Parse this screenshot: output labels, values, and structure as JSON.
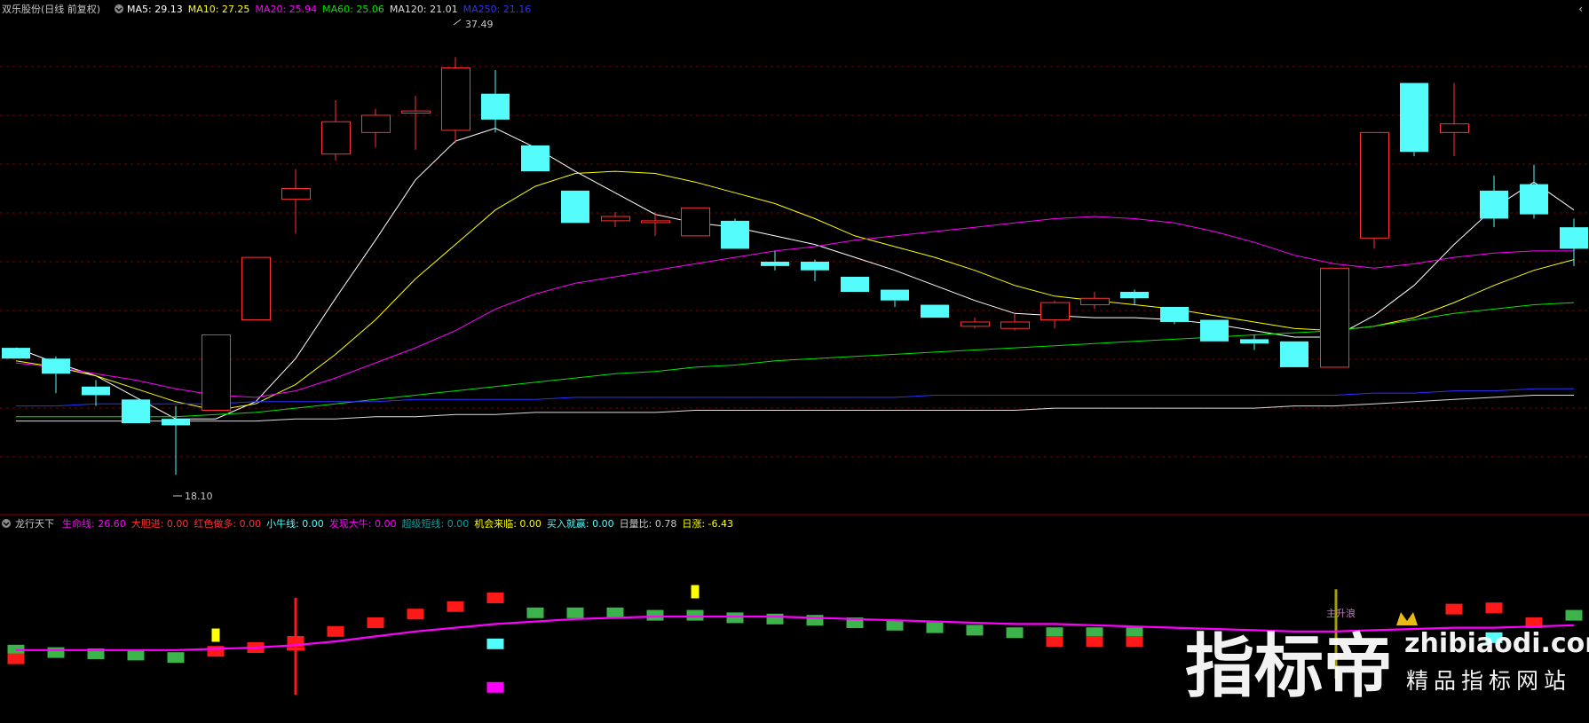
{
  "colors": {
    "background": "#000000",
    "up": "#ff3232",
    "down": "#54fcfc",
    "ma5": "#ffffff",
    "ma10": "#ffff00",
    "ma20": "#ff00ff",
    "ma60": "#00e600",
    "ma120": "#dcdcdc",
    "ma250": "#3030ff",
    "grid": "#7a0000",
    "separator": "#8b0000",
    "label_gray": "#c8c8c8"
  },
  "header": {
    "title": "双乐股份(日线 前复权)",
    "ma_items": [
      {
        "label": "MA5: 29.13",
        "color": "#ffffff"
      },
      {
        "label": "MA10: 27.25",
        "color": "#ffff00"
      },
      {
        "label": "MA20: 25.94",
        "color": "#ff00ff"
      },
      {
        "label": "MA60: 25.06",
        "color": "#00e600"
      },
      {
        "label": "MA120: 21.01",
        "color": "#dcdcdc"
      },
      {
        "label": "MA250: 21.16",
        "color": "#3030ff"
      }
    ],
    "max_label": "37.49",
    "min_label": "18.10"
  },
  "indicator_header": {
    "name": "龙行天下",
    "items": [
      {
        "label": "生命线: 26.60",
        "color": "#ff00ff"
      },
      {
        "label": "大胆进: 0.00",
        "color": "#ff3232"
      },
      {
        "label": "红色做多: 0.00",
        "color": "#ff3232"
      },
      {
        "label": "小牛线: 0.00",
        "color": "#54fcfc"
      },
      {
        "label": "发现大牛: 0.00",
        "color": "#ff00ff"
      },
      {
        "label": "超级短线: 0.00",
        "color": "#00a0a0"
      },
      {
        "label": "机会来临: 0.00",
        "color": "#ffff00"
      },
      {
        "label": "买入就赢: 0.00",
        "color": "#54fcfc"
      },
      {
        "label": "日量比: 0.78",
        "color": "#c8c8c8"
      },
      {
        "label": "日涨: -6.43",
        "color": "#ffff00"
      }
    ],
    "annotation": "主升浪"
  },
  "watermark": {
    "main": "指标帝",
    "domain": "zhibiaodi.com",
    "slogan": "精品指标网站"
  },
  "chart_data": [
    {
      "type": "candlestick",
      "title": "双乐股份(日线 前复权)",
      "ylim": [
        17.0,
        39.0
      ],
      "candles": [
        {
          "o": 24.0,
          "c": 23.5,
          "h": 24.0,
          "l": 23.5
        },
        {
          "o": 23.5,
          "c": 22.8,
          "h": 23.6,
          "l": 21.9
        },
        {
          "o": 22.2,
          "c": 21.8,
          "h": 22.5,
          "l": 21.3
        },
        {
          "o": 21.6,
          "c": 20.5,
          "h": 21.6,
          "l": 20.5
        },
        {
          "o": 20.7,
          "c": 20.4,
          "h": 21.3,
          "l": 18.1
        },
        {
          "o": 21.1,
          "c": 24.6,
          "h": 24.6,
          "l": 21.1
        },
        {
          "o": 25.3,
          "c": 28.2,
          "h": 28.2,
          "l": 25.3
        },
        {
          "o": 30.9,
          "c": 31.4,
          "h": 32.3,
          "l": 29.3
        },
        {
          "o": 33.0,
          "c": 34.5,
          "h": 35.5,
          "l": 32.7
        },
        {
          "o": 34.0,
          "c": 34.8,
          "h": 35.1,
          "l": 33.3
        },
        {
          "o": 34.9,
          "c": 35.0,
          "h": 35.7,
          "l": 33.2
        },
        {
          "o": 34.1,
          "c": 37.0,
          "h": 37.5,
          "l": 33.5
        },
        {
          "o": 35.8,
          "c": 34.6,
          "h": 36.9,
          "l": 34.0
        },
        {
          "o": 33.4,
          "c": 32.2,
          "h": 33.4,
          "l": 32.2
        },
        {
          "o": 31.3,
          "c": 29.8,
          "h": 31.3,
          "l": 29.8
        },
        {
          "o": 29.9,
          "c": 30.1,
          "h": 30.3,
          "l": 29.6
        },
        {
          "o": 29.9,
          "c": 29.9,
          "h": 30.3,
          "l": 29.2
        },
        {
          "o": 29.2,
          "c": 30.5,
          "h": 30.5,
          "l": 29.2
        },
        {
          "o": 29.9,
          "c": 28.6,
          "h": 30.0,
          "l": 28.6
        },
        {
          "o": 28.0,
          "c": 27.8,
          "h": 28.5,
          "l": 27.6
        },
        {
          "o": 28.0,
          "c": 27.6,
          "h": 28.1,
          "l": 27.1
        },
        {
          "o": 27.3,
          "c": 26.6,
          "h": 27.3,
          "l": 26.6
        },
        {
          "o": 26.7,
          "c": 26.2,
          "h": 26.7,
          "l": 25.9
        },
        {
          "o": 26.0,
          "c": 25.4,
          "h": 26.0,
          "l": 25.4
        },
        {
          "o": 25.0,
          "c": 25.2,
          "h": 25.4,
          "l": 24.9
        },
        {
          "o": 24.9,
          "c": 25.2,
          "h": 25.6,
          "l": 24.8
        },
        {
          "o": 25.3,
          "c": 26.1,
          "h": 26.2,
          "l": 24.9
        },
        {
          "o": 26.0,
          "c": 26.3,
          "h": 26.6,
          "l": 25.8
        },
        {
          "o": 26.6,
          "c": 26.3,
          "h": 26.7,
          "l": 26.0
        },
        {
          "o": 25.9,
          "c": 25.2,
          "h": 25.9,
          "l": 25.1
        },
        {
          "o": 25.3,
          "c": 24.3,
          "h": 25.3,
          "l": 24.3
        },
        {
          "o": 24.4,
          "c": 24.2,
          "h": 24.6,
          "l": 23.9
        },
        {
          "o": 24.3,
          "c": 23.1,
          "h": 24.3,
          "l": 23.1
        },
        {
          "o": 23.1,
          "c": 27.7,
          "h": 27.7,
          "l": 23.1
        },
        {
          "o": 29.1,
          "c": 34.0,
          "h": 34.0,
          "l": 28.6
        },
        {
          "o": 36.3,
          "c": 33.1,
          "h": 36.3,
          "l": 32.9
        },
        {
          "o": 34.0,
          "c": 34.4,
          "h": 36.3,
          "l": 32.9
        },
        {
          "o": 31.3,
          "c": 30.0,
          "h": 32.0,
          "l": 29.6
        },
        {
          "o": 31.6,
          "c": 30.2,
          "h": 32.5,
          "l": 30.0
        },
        {
          "o": 29.6,
          "c": 28.6,
          "h": 30.0,
          "l": 27.8
        }
      ],
      "series": [
        {
          "name": "MA5",
          "values": [
            24.0,
            23.3,
            22.7,
            21.7,
            20.7,
            20.7,
            21.5,
            23.5,
            26.3,
            29.0,
            31.8,
            33.6,
            34.2,
            33.3,
            32.2,
            31.2,
            30.2,
            29.8,
            29.6,
            29.2,
            28.8,
            28.2,
            27.6,
            26.9,
            26.2,
            25.6,
            25.5,
            25.4,
            25.4,
            25.3,
            25.1,
            24.8,
            24.5,
            24.5,
            25.5,
            26.9,
            28.8,
            30.5,
            31.7,
            30.4
          ]
        },
        {
          "name": "MA10",
          "values": [
            23.4,
            23.1,
            22.7,
            22.1,
            21.5,
            21.1,
            21.4,
            22.3,
            23.7,
            25.3,
            27.2,
            28.8,
            30.4,
            31.5,
            32.1,
            32.2,
            32.1,
            31.7,
            31.2,
            30.7,
            30.0,
            29.2,
            28.7,
            28.2,
            27.6,
            26.9,
            26.4,
            26.2,
            26.0,
            25.8,
            25.5,
            25.2,
            24.9,
            24.8,
            25.0,
            25.4,
            26.1,
            26.9,
            27.6,
            28.1
          ]
        },
        {
          "name": "MA20",
          "values": [
            23.3,
            23.1,
            22.8,
            22.5,
            22.1,
            21.8,
            21.7,
            22.0,
            22.6,
            23.3,
            24.0,
            24.8,
            25.8,
            26.5,
            27.0,
            27.3,
            27.6,
            27.9,
            28.2,
            28.5,
            28.7,
            29.0,
            29.2,
            29.4,
            29.6,
            29.8,
            30.0,
            30.1,
            30.0,
            29.8,
            29.4,
            28.9,
            28.3,
            27.9,
            27.7,
            27.9,
            28.2,
            28.4,
            28.5,
            28.5
          ]
        },
        {
          "name": "MA60",
          "values": [
            20.8,
            20.8,
            20.8,
            20.8,
            20.8,
            20.9,
            21.0,
            21.2,
            21.4,
            21.6,
            21.8,
            22.0,
            22.2,
            22.4,
            22.6,
            22.8,
            22.9,
            23.1,
            23.2,
            23.4,
            23.5,
            23.6,
            23.7,
            23.8,
            23.9,
            24.0,
            24.1,
            24.2,
            24.3,
            24.4,
            24.5,
            24.6,
            24.7,
            24.8,
            25.0,
            25.3,
            25.6,
            25.8,
            26.0,
            26.1
          ]
        },
        {
          "name": "MA120",
          "values": [
            20.6,
            20.6,
            20.6,
            20.6,
            20.6,
            20.6,
            20.6,
            20.7,
            20.7,
            20.8,
            20.8,
            20.9,
            20.9,
            21.0,
            21.0,
            21.0,
            21.0,
            21.1,
            21.1,
            21.1,
            21.1,
            21.1,
            21.1,
            21.1,
            21.1,
            21.1,
            21.2,
            21.2,
            21.2,
            21.2,
            21.2,
            21.2,
            21.3,
            21.3,
            21.4,
            21.5,
            21.6,
            21.7,
            21.8,
            21.8
          ]
        },
        {
          "name": "MA250",
          "values": [
            21.3,
            21.3,
            21.4,
            21.4,
            21.4,
            21.4,
            21.5,
            21.5,
            21.5,
            21.5,
            21.6,
            21.6,
            21.6,
            21.6,
            21.7,
            21.7,
            21.7,
            21.7,
            21.7,
            21.7,
            21.7,
            21.7,
            21.7,
            21.8,
            21.8,
            21.8,
            21.8,
            21.8,
            21.8,
            21.8,
            21.8,
            21.8,
            21.8,
            21.8,
            21.9,
            21.9,
            22.0,
            22.0,
            22.1,
            22.1
          ]
        }
      ],
      "max_marker": {
        "index": 11,
        "value": 37.49
      },
      "min_marker": {
        "index": 4,
        "value": 18.1
      }
    },
    {
      "type": "indicator",
      "title": "龙行天下",
      "ylim": [
        0,
        10
      ],
      "lifeline": [
        4.8,
        4.8,
        4.8,
        4.8,
        4.8,
        4.9,
        5.0,
        5.2,
        5.5,
        5.9,
        6.3,
        6.6,
        6.9,
        7.1,
        7.3,
        7.4,
        7.5,
        7.5,
        7.5,
        7.5,
        7.4,
        7.3,
        7.2,
        7.1,
        7.0,
        6.9,
        6.9,
        6.8,
        6.7,
        6.6,
        6.5,
        6.4,
        6.3,
        6.3,
        6.4,
        6.5,
        6.6,
        6.6,
        6.7,
        6.8
      ],
      "markers": [
        {
          "i": 0,
          "v": 4.8,
          "color": "green"
        },
        {
          "i": 0,
          "v": 4.1,
          "color": "red"
        },
        {
          "i": 1,
          "v": 4.6,
          "color": "green"
        },
        {
          "i": 2,
          "v": 4.5,
          "color": "green"
        },
        {
          "i": 3,
          "v": 4.4,
          "color": "green"
        },
        {
          "i": 4,
          "v": 4.2,
          "color": "green"
        },
        {
          "i": 5,
          "v": 4.7,
          "color": "red"
        },
        {
          "i": 5,
          "v": 6.0,
          "color": "yellow"
        },
        {
          "i": 6,
          "v": 5.0,
          "color": "red"
        },
        {
          "i": 7,
          "v": 5.5,
          "color": "red"
        },
        {
          "i": 8,
          "v": 6.3,
          "color": "red"
        },
        {
          "i": 9,
          "v": 7.0,
          "color": "red"
        },
        {
          "i": 10,
          "v": 7.7,
          "color": "red"
        },
        {
          "i": 11,
          "v": 8.3,
          "color": "red"
        },
        {
          "i": 12,
          "v": 9.0,
          "color": "red"
        },
        {
          "i": 12,
          "v": 5.3,
          "color": "cyan"
        },
        {
          "i": 12,
          "v": 1.8,
          "color": "magenta"
        },
        {
          "i": 13,
          "v": 7.8,
          "color": "green"
        },
        {
          "i": 14,
          "v": 7.8,
          "color": "green"
        },
        {
          "i": 15,
          "v": 7.8,
          "color": "green"
        },
        {
          "i": 16,
          "v": 7.6,
          "color": "green"
        },
        {
          "i": 17,
          "v": 7.6,
          "color": "green"
        },
        {
          "i": 17,
          "v": 9.5,
          "color": "yellow"
        },
        {
          "i": 18,
          "v": 7.4,
          "color": "green"
        },
        {
          "i": 19,
          "v": 7.3,
          "color": "green"
        },
        {
          "i": 20,
          "v": 7.2,
          "color": "green"
        },
        {
          "i": 21,
          "v": 7.0,
          "color": "green"
        },
        {
          "i": 22,
          "v": 6.8,
          "color": "green"
        },
        {
          "i": 23,
          "v": 6.6,
          "color": "green"
        },
        {
          "i": 24,
          "v": 6.4,
          "color": "green"
        },
        {
          "i": 25,
          "v": 6.2,
          "color": "green"
        },
        {
          "i": 26,
          "v": 6.2,
          "color": "green"
        },
        {
          "i": 26,
          "v": 5.5,
          "color": "red"
        },
        {
          "i": 27,
          "v": 6.2,
          "color": "green"
        },
        {
          "i": 27,
          "v": 5.5,
          "color": "red"
        },
        {
          "i": 28,
          "v": 6.2,
          "color": "green"
        },
        {
          "i": 28,
          "v": 5.5,
          "color": "red"
        },
        {
          "i": 36,
          "v": 8.1,
          "color": "red"
        },
        {
          "i": 37,
          "v": 8.2,
          "color": "red"
        },
        {
          "i": 37,
          "v": 5.8,
          "color": "cyan"
        },
        {
          "i": 38,
          "v": 7.0,
          "color": "red"
        },
        {
          "i": 39,
          "v": 7.6,
          "color": "green"
        }
      ],
      "bars": [
        {
          "i": 7,
          "lo": 1.2,
          "hi": 9.0,
          "color": "red"
        },
        {
          "i": 33,
          "lo": 2.5,
          "hi": 9.7,
          "color": "olive"
        }
      ],
      "annotation_index": 33
    }
  ]
}
